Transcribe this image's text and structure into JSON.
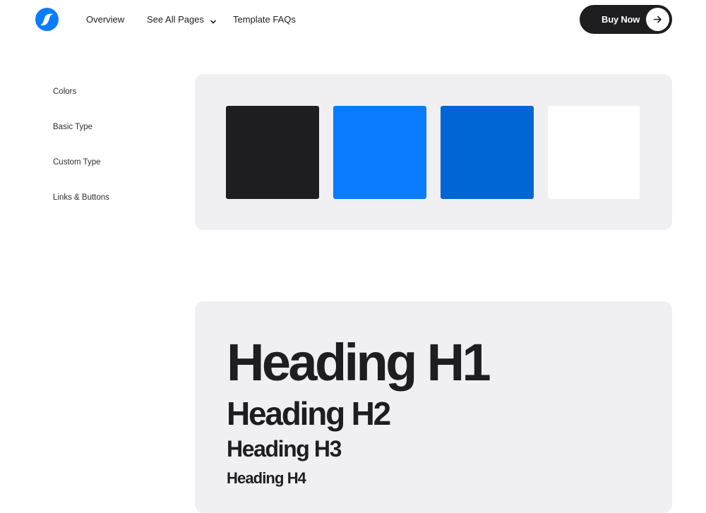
{
  "nav": {
    "logo_icon": "swoosh-s-logo-icon",
    "links": [
      {
        "label": "Overview"
      },
      {
        "label": "See All Pages",
        "icon": "chevron-down-icon"
      },
      {
        "label": "Template FAQs"
      }
    ],
    "cta": {
      "label": "Buy Now",
      "icon": "arrow-right-icon"
    }
  },
  "sidebar": {
    "items": [
      {
        "label": "Colors"
      },
      {
        "label": "Basic Type"
      },
      {
        "label": "Custom Type"
      },
      {
        "label": "Links & Buttons"
      }
    ]
  },
  "colors": {
    "accent": "#0a7cff",
    "swatches": [
      {
        "name": "dark",
        "hex": "#1e1e20"
      },
      {
        "name": "primary-blue",
        "hex": "#0a7cff"
      },
      {
        "name": "secondary-blue",
        "hex": "#0066d6"
      },
      {
        "name": "white",
        "hex": "#ffffff"
      }
    ],
    "panel_bg": "#f0f0f2"
  },
  "typography": {
    "headings": [
      {
        "label": "Heading H1"
      },
      {
        "label": "Heading H2"
      },
      {
        "label": "Heading H3"
      },
      {
        "label": "Heading H4"
      }
    ]
  }
}
